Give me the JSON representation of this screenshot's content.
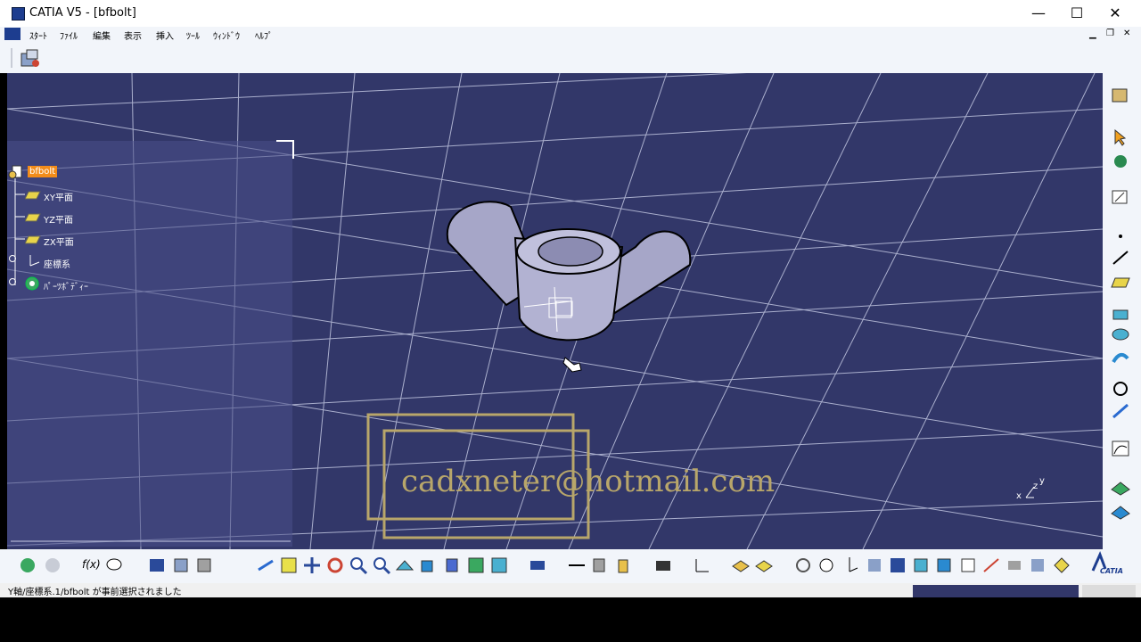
{
  "window": {
    "title": "CATIA V5 - [bfbolt]",
    "minimize": "—",
    "maximize": "☐",
    "close": "✕"
  },
  "menu": {
    "items": [
      "ｽﾀｰﾄ",
      "ﾌｧｲﾙ",
      "編集",
      "表示",
      "挿入",
      "ﾂｰﾙ",
      "ｳｨﾝﾄﾞｳ",
      "ﾍﾙﾌﾟ"
    ]
  },
  "tree": {
    "root": "bfbolt",
    "items": [
      "XY平面",
      "YZ平面",
      "ZX平面",
      "座標系",
      "ﾊﾟｰﾂﾎﾞﾃﾞｨｰ"
    ]
  },
  "watermark": "cadxneter@hotmail.com",
  "compass": {
    "x": "x",
    "y": "y",
    "z": "z"
  },
  "status": {
    "text": "Y軸/座標系.1/bfbolt が事前選択されました"
  },
  "bottom_toolbar": {
    "fx_label": "f(x)",
    "catia_label": "CATIA"
  },
  "colors": {
    "viewport": "#323769",
    "tree_highlight": "#f28c1a",
    "watermark": "#b8a66a"
  }
}
